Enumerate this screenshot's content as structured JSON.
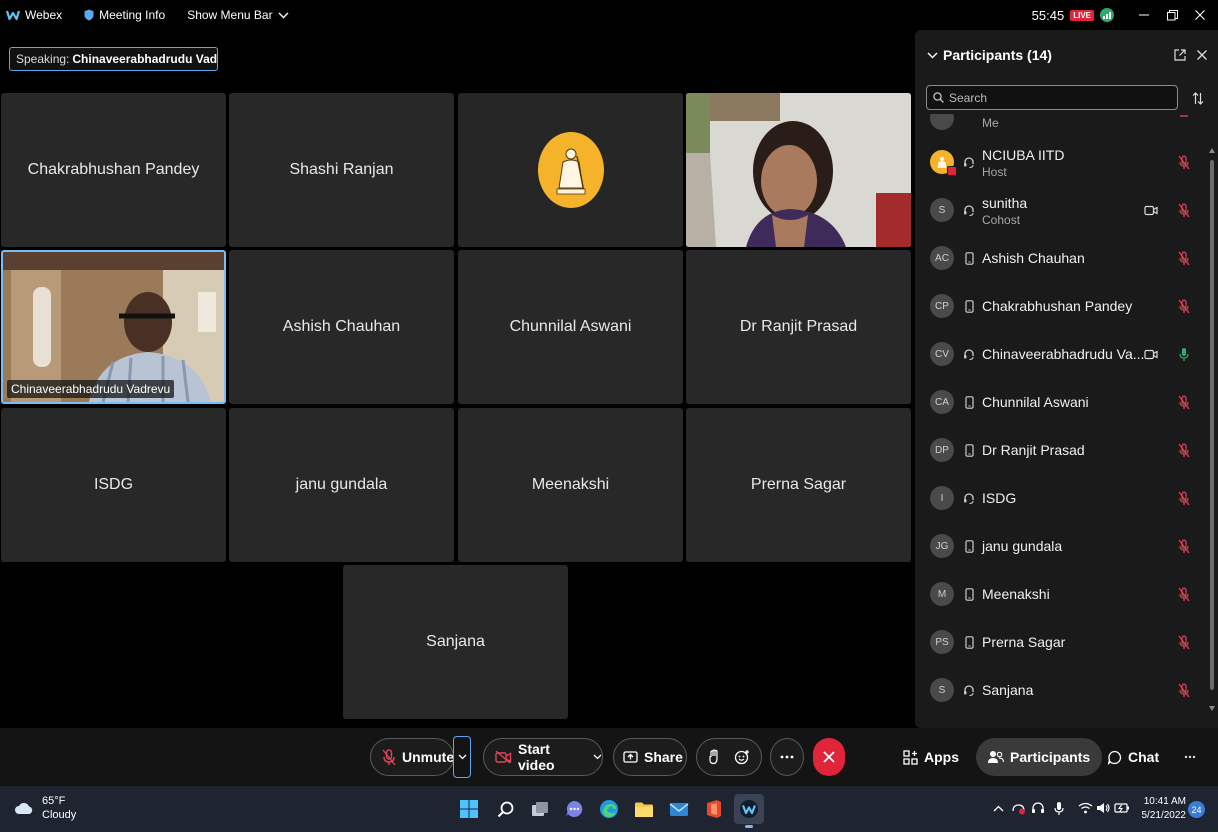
{
  "titlebar": {
    "app_name": "Webex",
    "meeting_info": "Meeting Info",
    "show_menu_bar": "Show Menu Bar",
    "timer": "55:45",
    "live_badge": "LIVE"
  },
  "speaking": {
    "label": "Speaking:",
    "name": "Chinaveerabhadrudu Vadrevu"
  },
  "grid": {
    "tiles": [
      {
        "name": "Chakrabhushan Pandey"
      },
      {
        "name": "Shashi Ranjan"
      },
      {
        "name": "Ashish Chauhan"
      },
      {
        "name": "Chunnilal Aswani"
      },
      {
        "name": "Dr Ranjit Prasad"
      },
      {
        "name": "ISDG"
      },
      {
        "name": "janu gundala"
      },
      {
        "name": "Meenakshi"
      },
      {
        "name": "Prerna Sagar"
      },
      {
        "name": "Sanjana"
      }
    ],
    "video_tile_name": "Chinaveerabhadrudu Vadrevu"
  },
  "panel": {
    "title": "Participants (14)",
    "search_placeholder": "Search",
    "me_label": "Me",
    "participants": [
      {
        "name": "NCIUBA IITD",
        "role": "Host",
        "initials": "",
        "device": "headset",
        "mic": "muted"
      },
      {
        "name": "sunitha",
        "role": "Cohost",
        "initials": "S",
        "device": "headset",
        "mic": "muted",
        "camera": true
      },
      {
        "name": "Ashish Chauhan",
        "initials": "AC",
        "device": "phone",
        "mic": "muted"
      },
      {
        "name": "Chakrabhushan Pandey",
        "initials": "CP",
        "device": "phone",
        "mic": "muted"
      },
      {
        "name": "Chinaveerabhadrudu Va...",
        "initials": "CV",
        "device": "headset",
        "mic": "active",
        "camera": true
      },
      {
        "name": "Chunnilal Aswani",
        "initials": "CA",
        "device": "phone",
        "mic": "muted"
      },
      {
        "name": "Dr Ranjit Prasad",
        "initials": "DP",
        "device": "phone",
        "mic": "muted"
      },
      {
        "name": "ISDG",
        "initials": "I",
        "device": "headset",
        "mic": "muted"
      },
      {
        "name": "janu gundala",
        "initials": "JG",
        "device": "phone",
        "mic": "muted"
      },
      {
        "name": "Meenakshi",
        "initials": "M",
        "device": "phone",
        "mic": "muted"
      },
      {
        "name": "Prerna Sagar",
        "initials": "PS",
        "device": "phone",
        "mic": "muted"
      },
      {
        "name": "Sanjana",
        "initials": "S",
        "device": "headset",
        "mic": "muted"
      }
    ]
  },
  "controls": {
    "unmute": "Unmute",
    "start_video": "Start video",
    "share": "Share",
    "apps": "Apps",
    "participants": "Participants",
    "chat": "Chat"
  },
  "taskbar": {
    "temperature": "65°F",
    "condition": "Cloudy",
    "time": "10:41 AM",
    "date": "5/21/2022",
    "notifications": "24"
  },
  "colors": {
    "accent_blue": "#5aa8f0",
    "leave_red": "#e0243a",
    "mute_red": "#e0445a",
    "mic_green": "#2faa6b",
    "tile_bg": "#282828",
    "panel_bg": "#1a1a1a"
  }
}
